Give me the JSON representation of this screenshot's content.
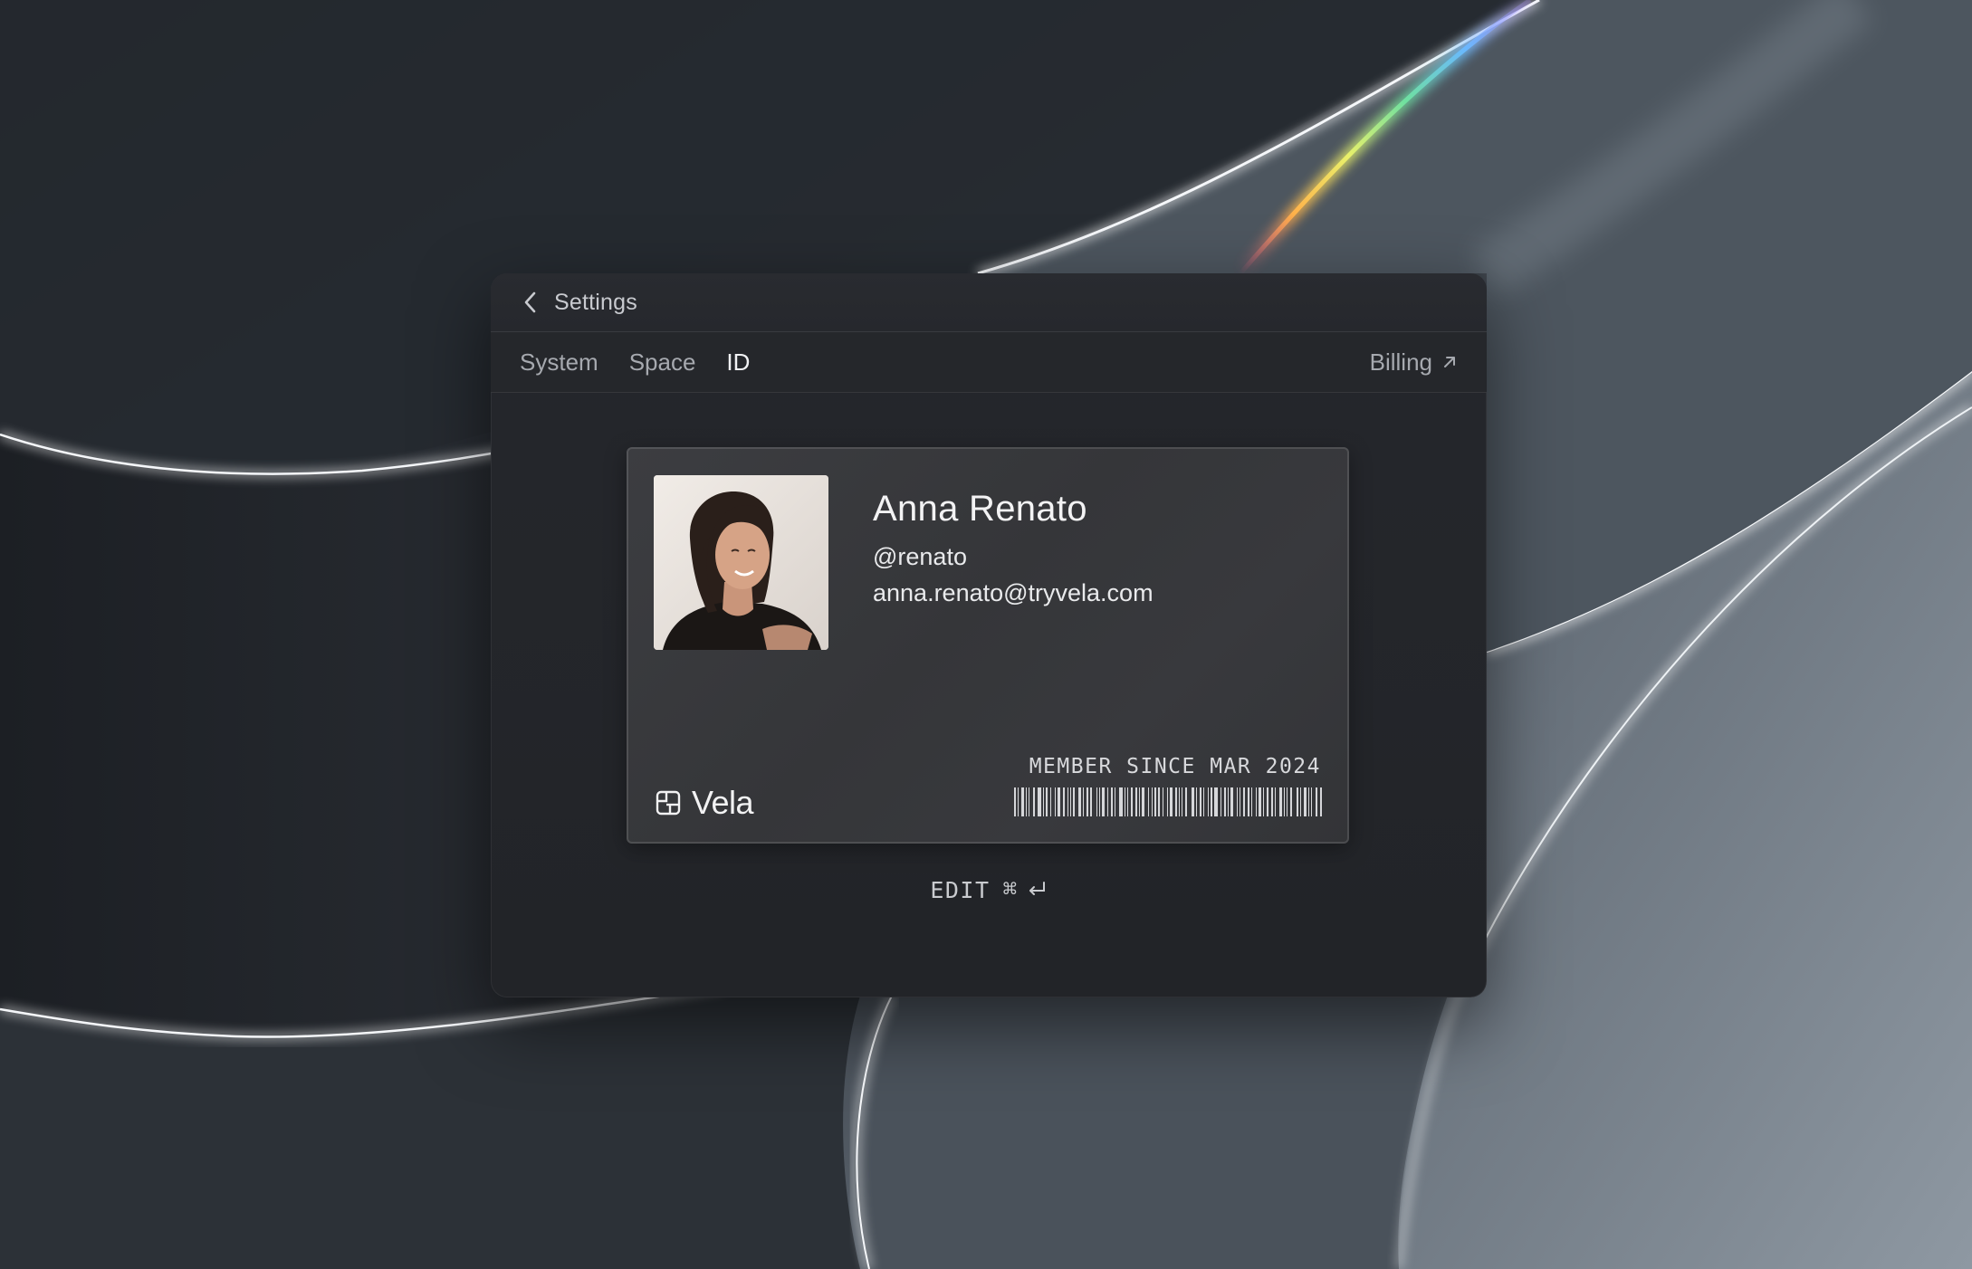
{
  "window": {
    "title": "Settings"
  },
  "tabs": [
    {
      "label": "System",
      "active": false
    },
    {
      "label": "Space",
      "active": false
    },
    {
      "label": "ID",
      "active": true
    }
  ],
  "billing": {
    "label": "Billing",
    "icon": "arrow-up-right-icon"
  },
  "card": {
    "name": "Anna Renato",
    "handle": "@renato",
    "email": "anna.renato@tryvela.com",
    "brand": "Vela",
    "member_since": "MEMBER SINCE MAR 2024",
    "photo": "profile-photo"
  },
  "edit": {
    "label": "EDIT",
    "shortcut_command": "⌘",
    "shortcut_enter": "return-icon"
  },
  "colors": {
    "window_bg": "#24262b",
    "card_bg": "#38393d",
    "text_primary": "#f2f2f4",
    "text_muted": "#a6a9af"
  }
}
